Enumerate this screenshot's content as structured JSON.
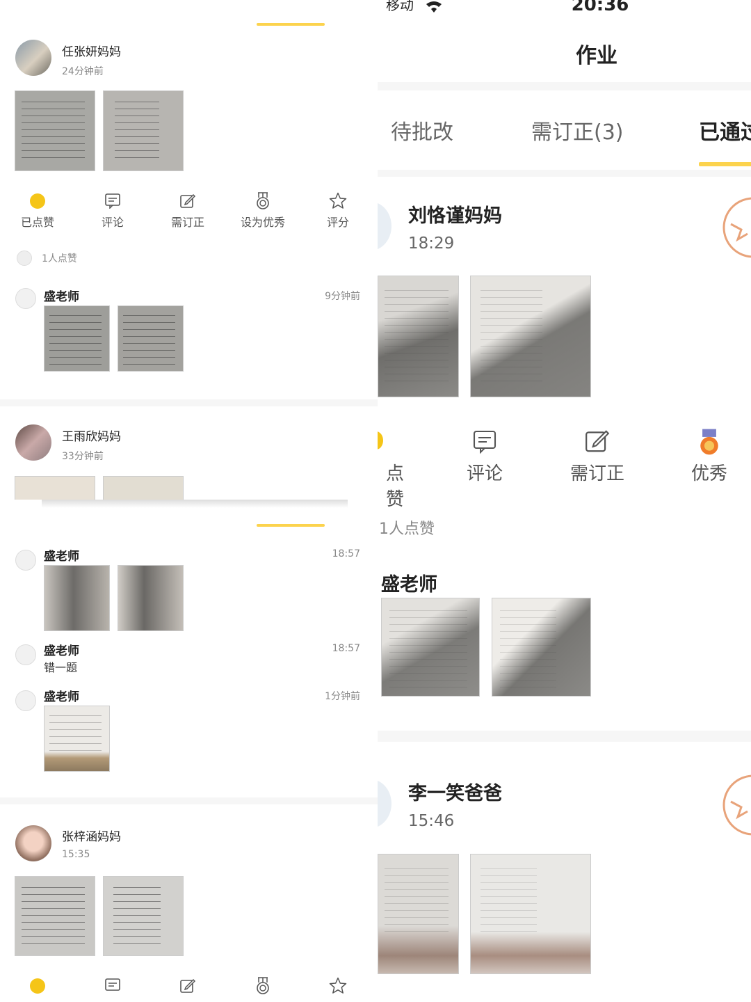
{
  "left_top": {
    "post1": {
      "author": "任张妍妈妈",
      "time": "24分钟前",
      "actions": [
        "已点赞",
        "评论",
        "需订正",
        "设为优秀",
        "评分"
      ],
      "likes": "1人点赞",
      "comment": {
        "author": "盛老师",
        "time": "9分钟前"
      }
    },
    "post2": {
      "author": "王雨欣妈妈",
      "time": "33分钟前"
    }
  },
  "left_bottom": {
    "comments": [
      {
        "author": "盛老师",
        "time": "18:57"
      },
      {
        "author": "盛老师",
        "time": "18:57",
        "text": "错一题"
      },
      {
        "author": "盛老师",
        "time": "1分钟前"
      }
    ],
    "post3": {
      "author": "张梓涵妈妈",
      "time": "15:35"
    }
  },
  "right": {
    "status": {
      "carrier": "移动",
      "time": "20:36"
    },
    "title": "作业",
    "tabs": [
      "待批改",
      "需订正(3)",
      "已通过"
    ],
    "post1": {
      "author": "刘恪谨妈妈",
      "time": "18:29",
      "actions": [
        "点赞",
        "评论",
        "需订正",
        "优秀"
      ],
      "likes": "1人点赞",
      "comment_author": "盛老师"
    },
    "post2": {
      "author": "李一笑爸爸",
      "time": "15:46"
    }
  },
  "colors": {
    "accent": "#fcd34d",
    "like": "#f5c518",
    "medal": "#f07c2a"
  }
}
